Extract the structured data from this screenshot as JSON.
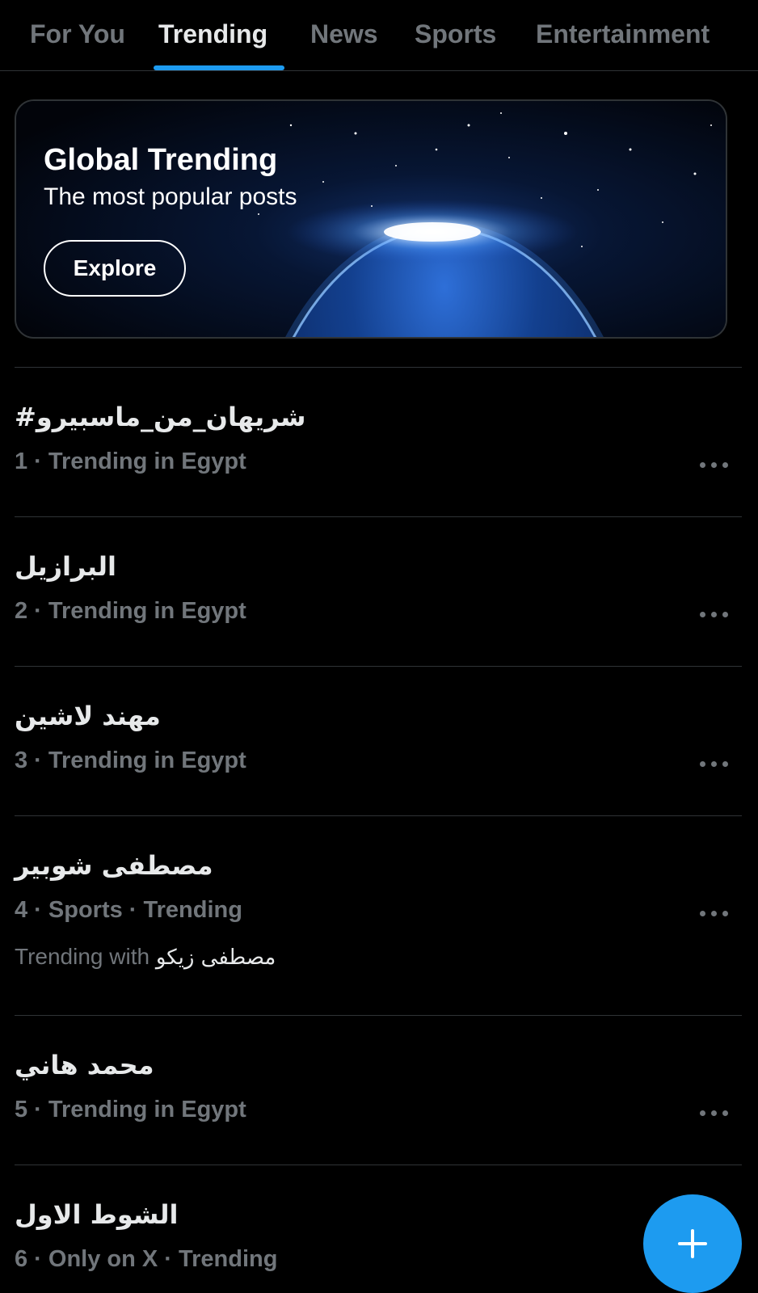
{
  "tabs": [
    {
      "label": "For You",
      "active": false
    },
    {
      "label": "Trending",
      "active": true
    },
    {
      "label": "News",
      "active": false
    },
    {
      "label": "Sports",
      "active": false
    },
    {
      "label": "Entertainment",
      "active": false
    }
  ],
  "banner": {
    "title": "Global Trending",
    "subtitle": "The most popular posts",
    "button_label": "Explore"
  },
  "trends": [
    {
      "name": "#شريهان_من_ماسبيرو",
      "meta": "1 · Trending in Egypt"
    },
    {
      "name": "البرازيل",
      "meta": "2 · Trending in Egypt"
    },
    {
      "name": "مهند لاشين",
      "meta": "3 · Trending in Egypt"
    },
    {
      "name": "مصطفى شوبير",
      "meta": "4 · Sports · Trending",
      "trending_with_label": "Trending with",
      "trending_with_value": "مصطفى زيكو"
    },
    {
      "name": "محمد هاني",
      "meta": "5 · Trending in Egypt"
    },
    {
      "name": "الشوط الاول",
      "meta": "6 · Only on X · Trending"
    }
  ],
  "icons": {
    "more": "ellipsis-icon",
    "compose": "plus-icon"
  },
  "colors": {
    "accent": "#1d9bf0",
    "background": "#000000",
    "secondary_text": "#71767b",
    "divider": "#2f3336"
  }
}
